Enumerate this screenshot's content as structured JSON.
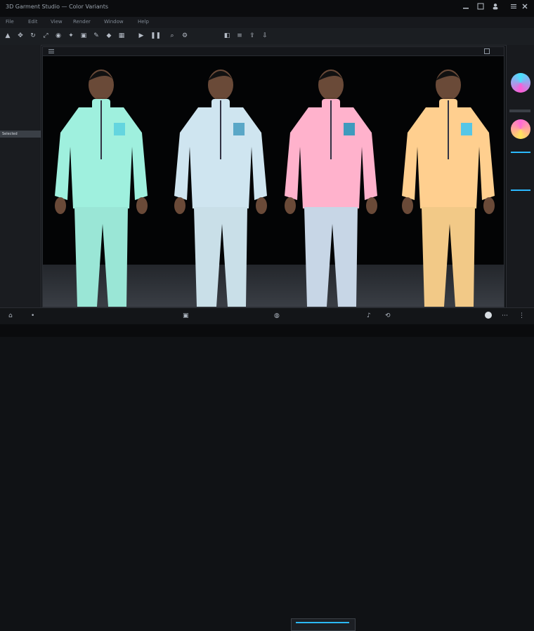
{
  "app": {
    "title": "3D Garment Studio — Color Variants"
  },
  "menu": [
    "File",
    "Edit",
    "View",
    "Render",
    "Window",
    "Help"
  ],
  "left_panel": {
    "rows": [
      "",
      "",
      "",
      "",
      "",
      "",
      "",
      "",
      "",
      "Selected",
      "",
      "",
      "",
      "",
      "",
      ""
    ]
  },
  "right_panel": {
    "swatches": [
      {
        "name": "swatch-teal-pink",
        "colors": [
          "#46e3ff",
          "#ff5bd6"
        ]
      },
      {
        "name": "swatch-rainbow",
        "colors": [
          "#ff6ad5",
          "#ffe45c"
        ]
      }
    ]
  },
  "figures": [
    {
      "name": "variant-mint",
      "jacket": "#9ff0de",
      "pants": "#9ae6d6",
      "chest_patch": "#64d5df"
    },
    {
      "name": "variant-ice",
      "jacket": "#cfe5f0",
      "pants": "#c9dfe8",
      "chest_patch": "#5aa7c7"
    },
    {
      "name": "variant-pink",
      "jacket": "#ffb2cc",
      "pants": "#c7d6e6",
      "chest_patch": "#3f9bbd"
    },
    {
      "name": "variant-peach",
      "jacket": "#ffcf8f",
      "pants": "#f2c987",
      "chest_patch": "#56c6e7"
    }
  ],
  "colors": {
    "accent": "#2bb9ff",
    "bg": "#101215"
  }
}
